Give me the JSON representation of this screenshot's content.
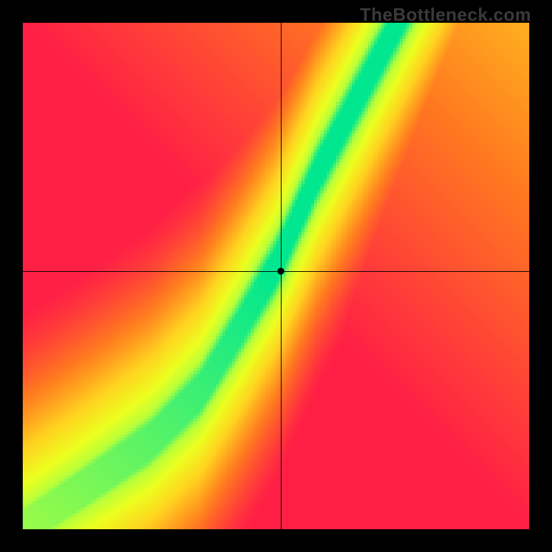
{
  "watermark": {
    "text": "TheBottleneck.com"
  },
  "chart_data": {
    "type": "heatmap",
    "title": "",
    "xlabel": "",
    "ylabel": "",
    "xlim": [
      0,
      1
    ],
    "ylim": [
      0,
      1
    ],
    "crosshair": {
      "x": 0.51,
      "y": 0.51
    },
    "marker": {
      "x": 0.51,
      "y": 0.51
    },
    "color_stops": [
      {
        "value": 0.0,
        "color": "#ff1f45"
      },
      {
        "value": 0.3,
        "color": "#ff7a1f"
      },
      {
        "value": 0.55,
        "color": "#ffd21f"
      },
      {
        "value": 0.75,
        "color": "#ecff1f"
      },
      {
        "value": 0.88,
        "color": "#b8ff3a"
      },
      {
        "value": 1.0,
        "color": "#00e78f"
      }
    ],
    "ridge": {
      "control_points": [
        {
          "x": 0.0,
          "y": 0.0
        },
        {
          "x": 0.12,
          "y": 0.08
        },
        {
          "x": 0.25,
          "y": 0.17
        },
        {
          "x": 0.35,
          "y": 0.27
        },
        {
          "x": 0.43,
          "y": 0.4
        },
        {
          "x": 0.5,
          "y": 0.52
        },
        {
          "x": 0.58,
          "y": 0.7
        },
        {
          "x": 0.66,
          "y": 0.85
        },
        {
          "x": 0.74,
          "y": 1.0
        }
      ],
      "core_width": 0.035,
      "falloff": 0.4
    },
    "corner_bias": {
      "top_right_boost": 0.45,
      "bottom_left_suppress": 0.1
    }
  }
}
